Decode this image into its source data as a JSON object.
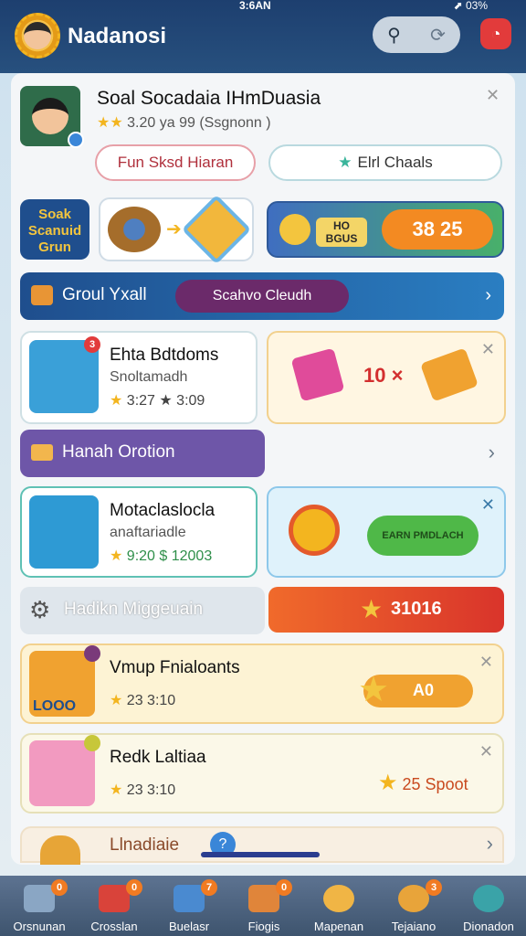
{
  "status": {
    "time": "3:6AN",
    "right": "⬈ 03%"
  },
  "header": {
    "title": "Nadanosi",
    "search_icon": "search-icon",
    "sync_icon": "sync-icon"
  },
  "profile": {
    "name": "Soal Socadaia IHmDuasia",
    "rating": "3.20 ya 99 (Ssgnonn )",
    "btn1": "Fun Sksd Hiaran",
    "btn2": "Elrl Chaals"
  },
  "promo": {
    "logo": "Soak Scanuid Grun",
    "coin_label": "HO BGUS",
    "coin_value": "38 25"
  },
  "section1": {
    "label": "Groul Yxall",
    "tag": "Scahvo Cleudh"
  },
  "card1": {
    "title": "Ehta Bdtdoms",
    "sub": "Snoltamadh",
    "meta": "3:27 ★ 3:09",
    "reward": "10 ×",
    "badge": "3"
  },
  "section2": {
    "label": "Hanah Orotion"
  },
  "card2": {
    "title": "Motaclaslocla",
    "sub": "anaftariadle",
    "meta": "9:20 $ 12003",
    "btn": "EARN PMDLACH"
  },
  "section3": {
    "label": "Hadikn Miggeuain",
    "value": "31016"
  },
  "card3": {
    "title": "Vmup Fnialoants",
    "meta": "23 3:10",
    "value": "A0",
    "thumb_label": "LOOO"
  },
  "card4": {
    "title": "Redk Laltiaa",
    "meta": "23 3:10",
    "value": "25 Spoot"
  },
  "card5": {
    "title": "Llnadiaie"
  },
  "tabs": [
    {
      "label": "Orsnunan",
      "badge": "0"
    },
    {
      "label": "Crosslan",
      "badge": "0"
    },
    {
      "label": "Buelasr",
      "badge": "7"
    },
    {
      "label": "Fiogis",
      "badge": "0"
    },
    {
      "label": "Mapenan",
      "badge": ""
    },
    {
      "label": "Tejaiano",
      "badge": "3"
    },
    {
      "label": "Dionadon",
      "badge": ""
    }
  ]
}
